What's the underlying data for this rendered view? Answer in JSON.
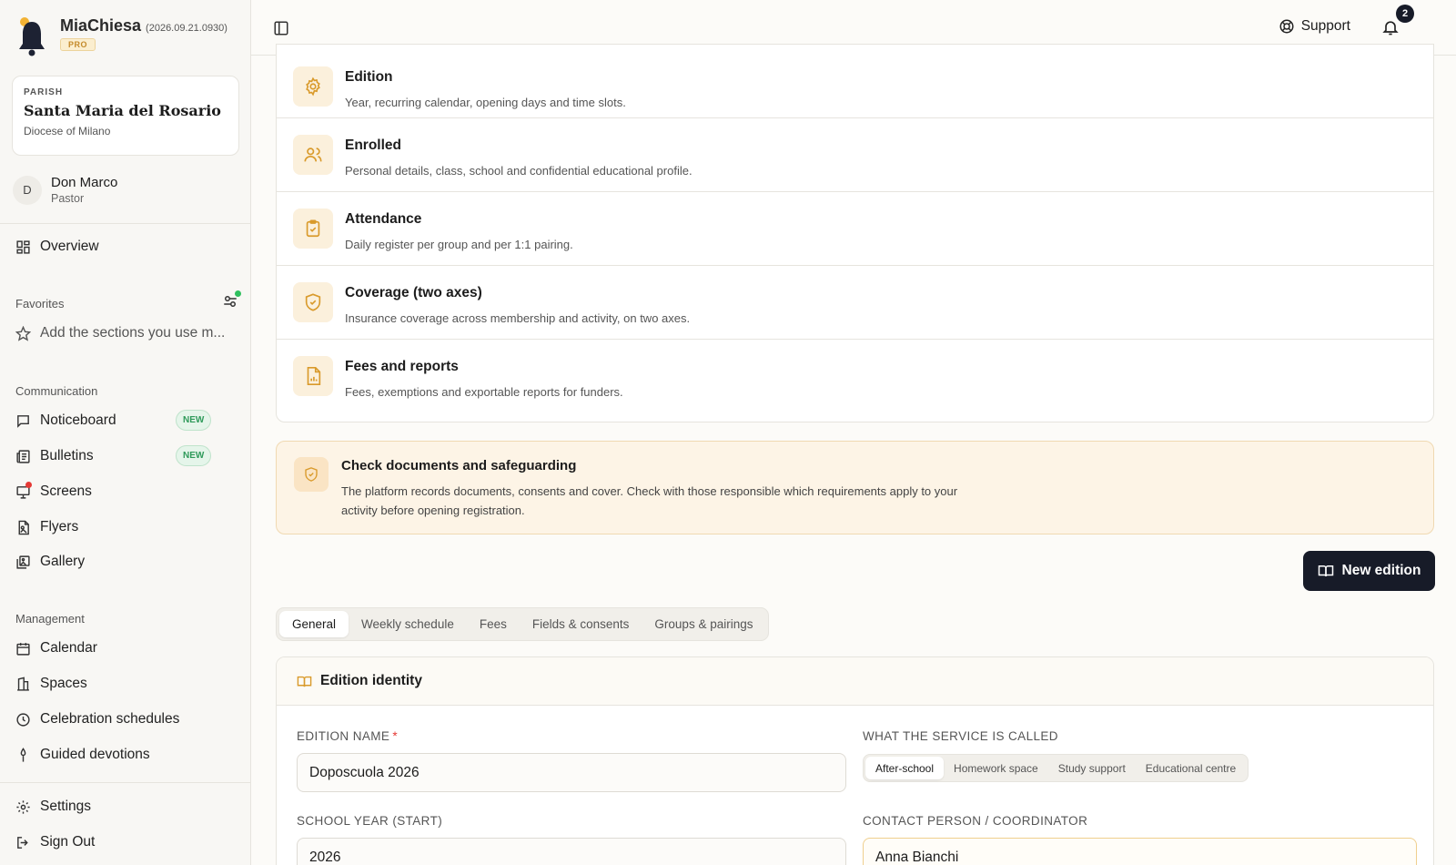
{
  "app": {
    "name": "MiaChiesa",
    "version": "(2026.09.21.0930)",
    "plan": "PRO"
  },
  "parish": {
    "label": "PARISH",
    "name": "Santa Maria del Rosario",
    "diocese": "Diocese of Milano"
  },
  "user": {
    "initial": "D",
    "name": "Don Marco",
    "role": "Pastor"
  },
  "sidebar": {
    "overview": "Overview",
    "favorites_label": "Favorites",
    "favorites_hint": "Add the sections you use m...",
    "communication_label": "Communication",
    "communication": [
      {
        "label": "Noticeboard",
        "badge": "NEW"
      },
      {
        "label": "Bulletins",
        "badge": "NEW"
      },
      {
        "label": "Screens"
      },
      {
        "label": "Flyers"
      },
      {
        "label": "Gallery"
      }
    ],
    "management_label": "Management",
    "management": [
      {
        "label": "Calendar"
      },
      {
        "label": "Spaces"
      },
      {
        "label": "Celebration schedules"
      },
      {
        "label": "Guided devotions"
      }
    ],
    "settings": "Settings",
    "sign_out": "Sign Out"
  },
  "topbar": {
    "support": "Support",
    "notification_count": "2"
  },
  "modules": [
    {
      "icon": "gear-icon",
      "title": "Edition",
      "desc": "Year, recurring calendar, opening days and time slots."
    },
    {
      "icon": "users-icon",
      "title": "Enrolled",
      "desc": "Personal details, class, school and confidential educational profile."
    },
    {
      "icon": "clipboard-check-icon",
      "title": "Attendance",
      "desc": "Daily register per group and per 1:1 pairing."
    },
    {
      "icon": "shield-check-icon",
      "title": "Coverage (two axes)",
      "desc": "Insurance coverage across membership and activity, on two axes."
    },
    {
      "icon": "file-chart-icon",
      "title": "Fees and reports",
      "desc": "Fees, exemptions and exportable reports for funders."
    }
  ],
  "notice": {
    "title": "Check documents and safeguarding",
    "text": "The platform records documents, consents and cover. Check with those responsible which requirements apply to your activity before opening registration."
  },
  "new_edition_button": "New edition",
  "tabs": [
    {
      "label": "General",
      "active": true
    },
    {
      "label": "Weekly schedule"
    },
    {
      "label": "Fees"
    },
    {
      "label": "Fields & consents"
    },
    {
      "label": "Groups & pairings"
    }
  ],
  "form": {
    "section_title": "Edition identity",
    "edition_name_label": "EDITION NAME",
    "edition_name_required": "*",
    "edition_name_value": "Doposcuola 2026",
    "service_label": "WHAT THE SERVICE IS CALLED",
    "service_options": [
      "After-school",
      "Homework space",
      "Study support",
      "Educational centre"
    ],
    "service_selected": "After-school",
    "school_year_label": "SCHOOL YEAR (START)",
    "school_year_value": "2026",
    "contact_label": "CONTACT PERSON / COORDINATOR",
    "contact_value": "Anna Bianchi"
  },
  "colors": {
    "accent": "#d99a2b",
    "dark_button": "#171b28",
    "new_badge": "#2f9a5a",
    "alert_dot": "#e53935"
  }
}
